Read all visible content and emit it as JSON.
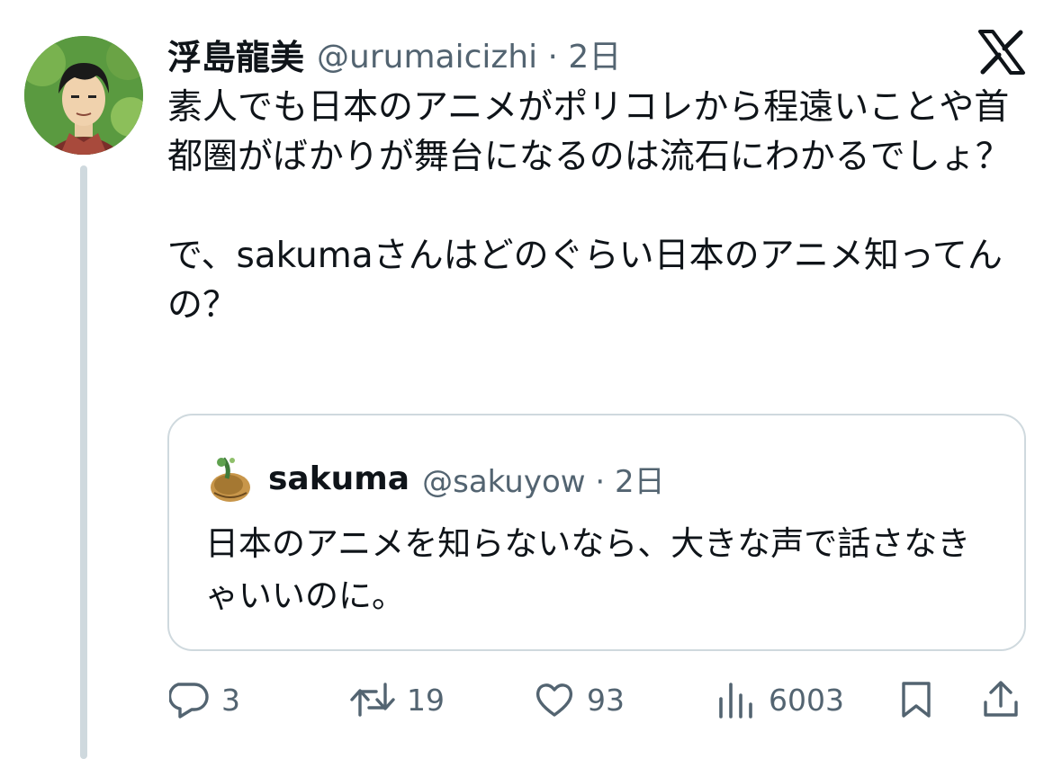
{
  "author": {
    "display_name": "浮島龍美",
    "handle_time": "@urumaicizhi · 2日"
  },
  "tweet": {
    "text": "素人でも日本のアニメがポリコレから程遠いことや首都圏がばかりが舞台になるのは流石にわかるでしょ？\n\nで、sakumaさんはどのぐらい日本のアニメ知ってんの？"
  },
  "quoted": {
    "display_name": "sakuma",
    "handle_time": "@sakuyow · 2日",
    "text": "日本のアニメを知らないなら、大きな声で話さなきゃいいのに。"
  },
  "actions": {
    "replies": "3",
    "retweets": "19",
    "likes": "93",
    "views": "6003"
  },
  "icons": {
    "brand": "x-logo-icon",
    "reply": "reply-icon",
    "retweet": "retweet-icon",
    "like": "heart-icon",
    "views": "views-icon",
    "bookmark": "bookmark-icon",
    "share": "share-icon"
  },
  "colors": {
    "text": "#0f1419",
    "secondary": "#536471",
    "border": "#cfd9de"
  }
}
